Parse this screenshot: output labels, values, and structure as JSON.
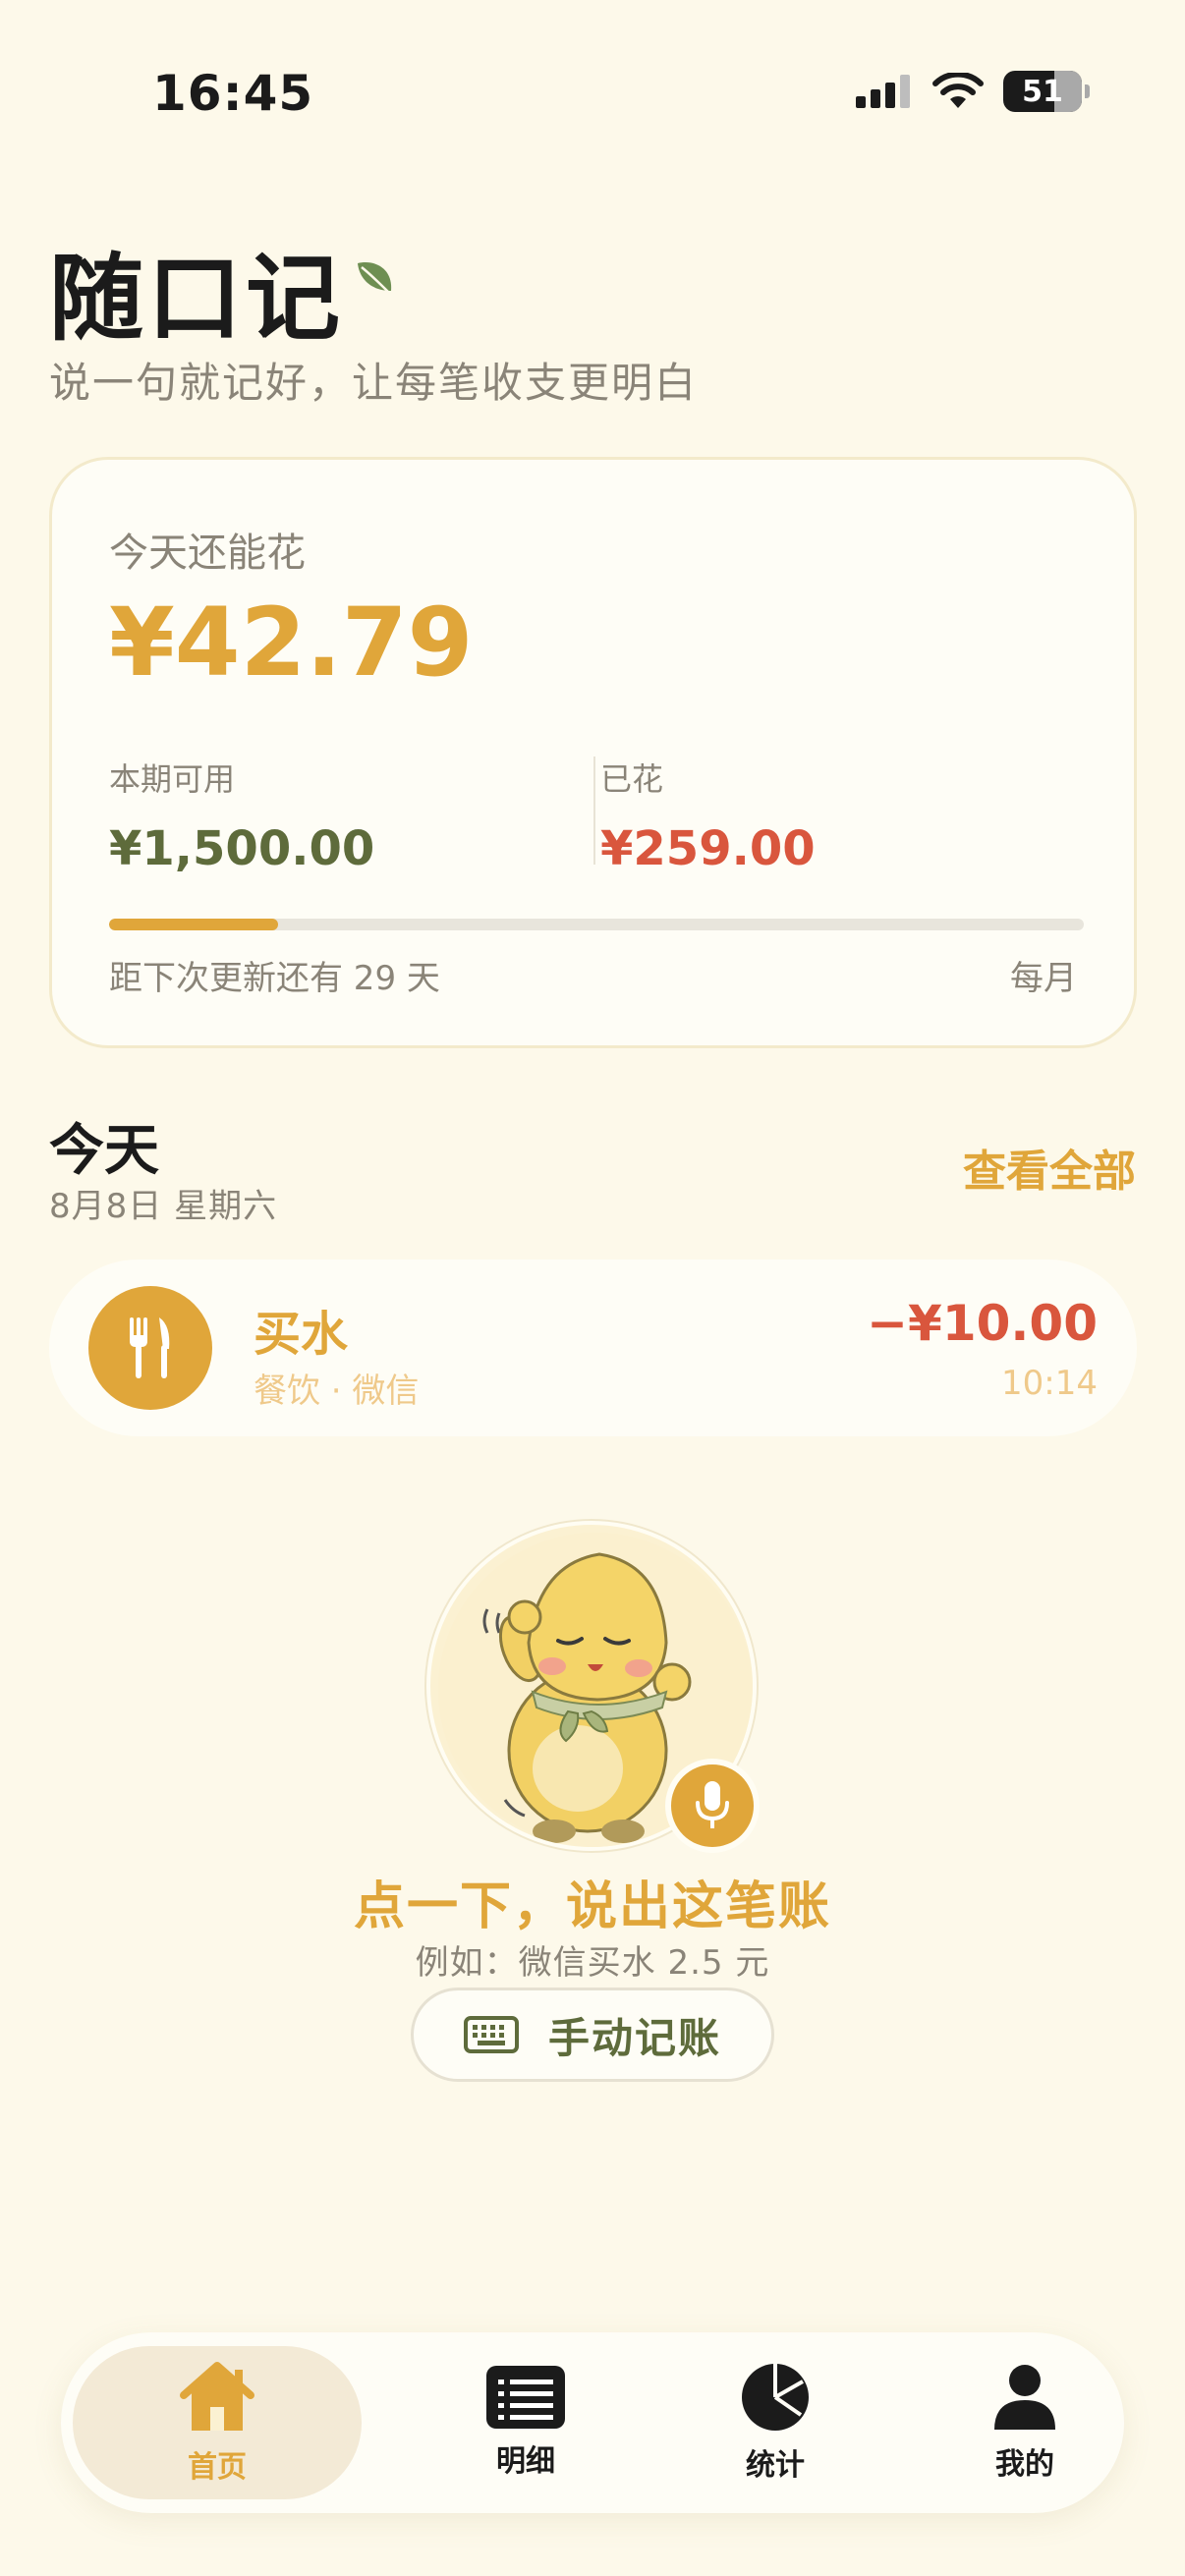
{
  "status_bar": {
    "time": "16:45",
    "battery": "51"
  },
  "header": {
    "title": "随口记",
    "subtitle": "说一句就记好，让每笔收支更明白"
  },
  "budget": {
    "label": "今天还能花",
    "amount": "¥42.79",
    "available_label": "本期可用",
    "available_value": "¥1,500.00",
    "spent_label": "已花",
    "spent_value": "¥259.00",
    "progress_fraction": 0.173,
    "footer_left": "距下次更新还有 29 天",
    "footer_right": "每月"
  },
  "today": {
    "title": "今天",
    "date": "8月8日 星期六",
    "view_all": "查看全部",
    "transactions": [
      {
        "name": "买水",
        "meta": "餐饮 · 微信",
        "amount": "−¥10.00",
        "time": "10:14",
        "icon": "fork-knife-icon"
      }
    ]
  },
  "voice": {
    "title": "点一下，说出这笔账",
    "hint": "例如：微信买水 2.5 元",
    "manual_label": "手动记账"
  },
  "tabs": [
    {
      "label": "首页",
      "icon": "home-icon",
      "active": true
    },
    {
      "label": "明细",
      "icon": "list-icon",
      "active": false
    },
    {
      "label": "统计",
      "icon": "pie-chart-icon",
      "active": false
    },
    {
      "label": "我的",
      "icon": "person-icon",
      "active": false
    }
  ],
  "colors": {
    "accent": "#E0A63A",
    "expense": "#D9563D",
    "green": "#5E6B3B",
    "background": "#FDF9EA"
  }
}
